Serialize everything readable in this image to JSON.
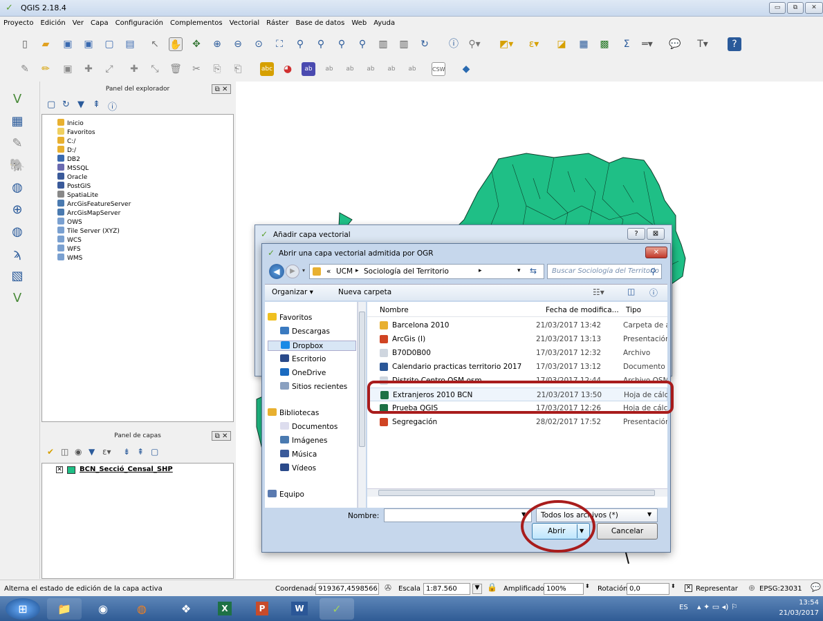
{
  "app": {
    "title": "QGIS 2.18.4"
  },
  "menu": [
    "Proyecto",
    "Edición",
    "Ver",
    "Capa",
    "Configuración",
    "Complementos",
    "Vectorial",
    "Ráster",
    "Base de datos",
    "Web",
    "Ayuda"
  ],
  "browser_panel": {
    "title": "Panel del explorador",
    "items": [
      "Inicio",
      "Favoritos",
      "C:/",
      "D:/",
      "DB2",
      "MSSQL",
      "Oracle",
      "PostGIS",
      "SpatiaLite",
      "ArcGisFeatureServer",
      "ArcGisMapServer",
      "OWS",
      "Tile Server (XYZ)",
      "WCS",
      "WFS",
      "WMS"
    ]
  },
  "layers_panel": {
    "title": "Panel de capas",
    "layer_name": "BCN_Secció_Censal_SHP",
    "layer_color": "#1fbf86"
  },
  "outer_dialog": {
    "title": "Añadir capa vectorial",
    "help_label": "?",
    "close_label": "⊠"
  },
  "file_dialog": {
    "title": "Abrir una capa vectorial admitida por OGR",
    "path": [
      "«",
      "UCM",
      "Sociología del Territorio"
    ],
    "search_placeholder": "Buscar Sociología del Territorio",
    "organize_label": "Organizar ▾",
    "new_folder_label": "Nueva carpeta",
    "nav": {
      "favorites": "Favoritos",
      "fav_items": [
        "Descargas",
        "Dropbox",
        "Escritorio",
        "OneDrive",
        "Sitios recientes"
      ],
      "libraries": "Bibliotecas",
      "lib_items": [
        "Documentos",
        "Imágenes",
        "Música",
        "Vídeos"
      ],
      "computer": "Equipo"
    },
    "columns": {
      "name": "Nombre",
      "date": "Fecha de modifica...",
      "type": "Tipo"
    },
    "files": [
      {
        "name": "Barcelona 2010",
        "date": "21/03/2017 13:42",
        "type": "Carpeta de a",
        "icon": "folder"
      },
      {
        "name": "ArcGis (I)",
        "date": "21/03/2017 13:13",
        "type": "Presentación",
        "icon": "ppt"
      },
      {
        "name": "B70D0B00",
        "date": "17/03/2017 12:32",
        "type": "Archivo",
        "icon": "file"
      },
      {
        "name": "Calendario practicas territorio 2017",
        "date": "17/03/2017 13:12",
        "type": "Documento",
        "icon": "doc"
      },
      {
        "name": "Distrito Centro OSM.osm",
        "date": "17/03/2017 12:44",
        "type": "Archivo OSM",
        "icon": "file"
      },
      {
        "name": "Extranjeros 2010 BCN",
        "date": "21/03/2017 13:50",
        "type": "Hoja de cálc",
        "icon": "xls"
      },
      {
        "name": "Prueba QGIS",
        "date": "17/03/2017 12:26",
        "type": "Hoja de cálc",
        "icon": "xls"
      },
      {
        "name": "Segregación",
        "date": "28/02/2017 17:52",
        "type": "Presentación",
        "icon": "ppt"
      }
    ],
    "filename_label": "Nombre:",
    "filename_value": "",
    "filter_value": "Todos los archivos (*)",
    "open_label": "Abrir",
    "cancel_label": "Cancelar"
  },
  "status": {
    "hint": "Alterna el estado de edición de la capa activa",
    "coord_label": "Coordenada",
    "coord_value": "919367,4598566",
    "scale_label": "Escala",
    "scale_value": "1:87.560",
    "magnifier_label": "Amplificador",
    "magnifier_value": "100%",
    "rotation_label": "Rotación",
    "rotation_value": "0,0",
    "render_label": "Representar",
    "crs_label": "EPSG:23031"
  },
  "taskbar": {
    "lang": "ES",
    "time": "13:54",
    "date": "21/03/2017"
  },
  "colors": {
    "map_fill": "#1fbf86",
    "highlight": "#a81c1c"
  }
}
